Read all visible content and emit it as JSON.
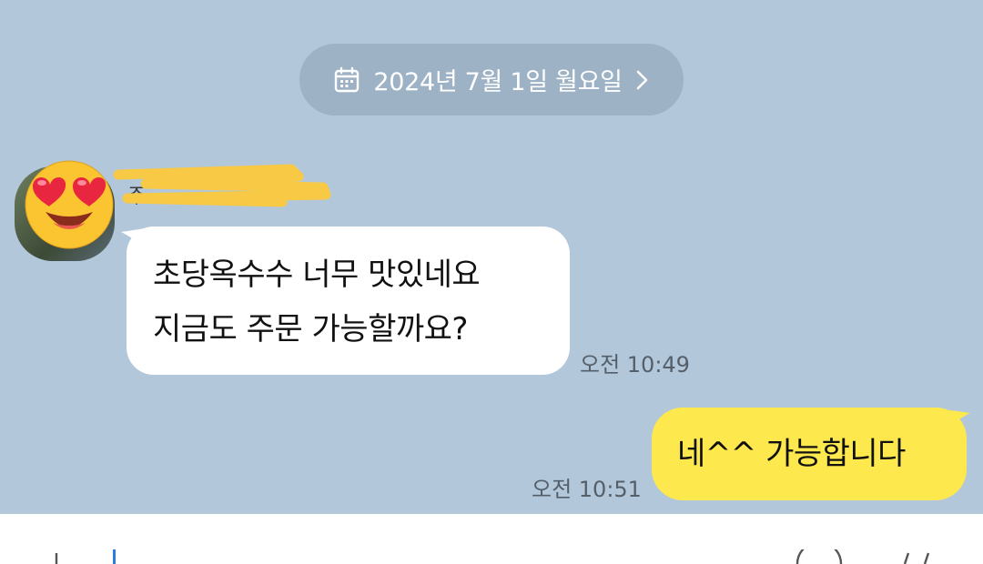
{
  "date_divider": {
    "label": "2024년 7월 1일 월요일",
    "chevron": "›"
  },
  "incoming": {
    "sender_name": "주...",
    "avatar_overlay": "heart-eyes-emoji",
    "text": "초당옥수수 너무 맛있네요\n지금도 주문 가능할까요?",
    "time": "오전 10:49"
  },
  "outgoing": {
    "text": "네^^ 가능합니다",
    "time": "오전 10:51"
  },
  "colors": {
    "chat_bg": "#b2c7da",
    "incoming_bubble": "#ffffff",
    "outgoing_bubble": "#fde84d",
    "redaction": "#f7c945"
  },
  "input_bar": {
    "icons": [
      "plus-icon",
      "emoji-icon",
      "hash-icon"
    ]
  }
}
